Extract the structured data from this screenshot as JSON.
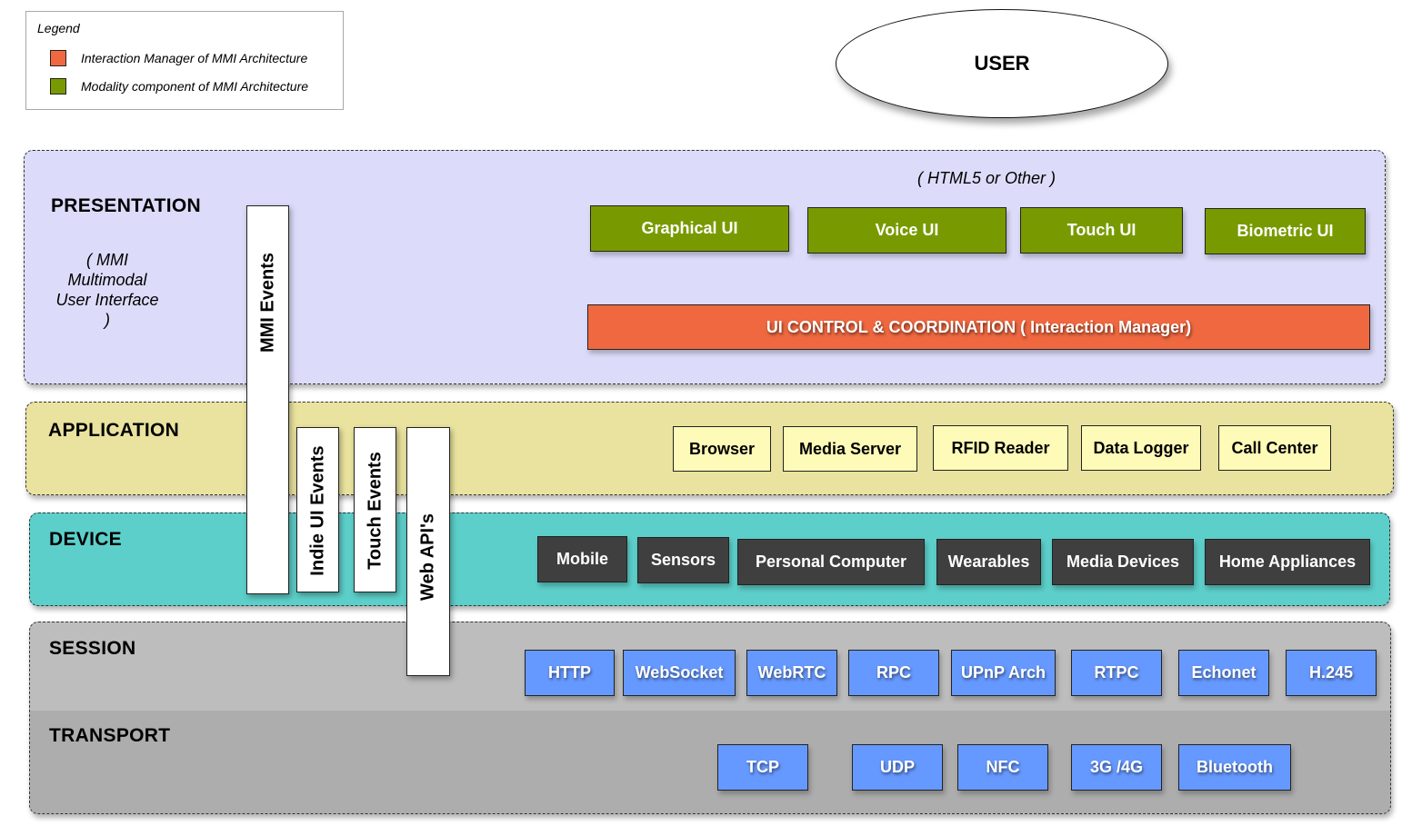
{
  "legend": {
    "title": "Legend",
    "items": [
      {
        "label": "Interaction Manager of MMI Architecture",
        "color": "#f06840"
      },
      {
        "label": "Modality component of MMI Architecture",
        "color": "#789a00"
      }
    ]
  },
  "user": {
    "label": "USER"
  },
  "layers": {
    "presentation": {
      "title": "PRESENTATION",
      "subtitle": "( MMI Multimodal User Interface )",
      "note": "( HTML5  or Other )",
      "modalities": [
        "Graphical UI",
        "Voice UI",
        "Touch UI",
        "Biometric UI"
      ],
      "interaction_manager": "UI CONTROL & COORDINATION ( Interaction Manager)",
      "color": "#dcdcfa"
    },
    "application": {
      "title": "APPLICATION",
      "items": [
        "Browser",
        "Media Server",
        "RFID Reader",
        "Data Logger",
        "Call Center"
      ],
      "color": "#eae39f"
    },
    "device": {
      "title": "DEVICE",
      "items": [
        "Mobile",
        "Sensors",
        "Personal Computer",
        "Wearables",
        "Media Devices",
        "Home Appliances"
      ],
      "color": "#5dcfca"
    },
    "session": {
      "title": "SESSION",
      "items": [
        "HTTP",
        "WebSocket",
        "WebRTC",
        "RPC",
        "UPnP Arch",
        "RTPC",
        "Echonet",
        "H.245"
      ],
      "color": "#bdbdbd"
    },
    "transport": {
      "title": "TRANSPORT",
      "items": [
        "TCP",
        "UDP",
        "NFC",
        "3G /4G",
        "Bluetooth"
      ],
      "color": "#adadad"
    }
  },
  "event_bars": [
    "MMI Events",
    "Indie UI Events",
    "Touch Events",
    "Web API's"
  ]
}
